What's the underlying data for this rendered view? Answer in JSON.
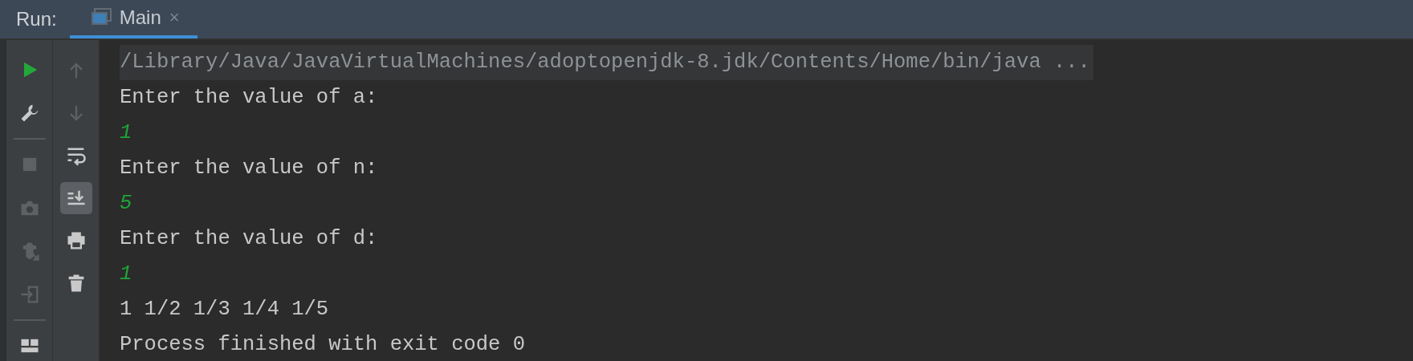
{
  "header": {
    "label": "Run:",
    "tabs": [
      {
        "label": "Main",
        "close": "×",
        "selected": true
      }
    ]
  },
  "left_toolbar": [
    {
      "kind": "run",
      "disabled": false
    },
    {
      "kind": "wrench",
      "disabled": false
    },
    {
      "kind": "separator"
    },
    {
      "kind": "stop",
      "disabled": true
    },
    {
      "kind": "camera",
      "disabled": true
    },
    {
      "kind": "bug",
      "disabled": true
    },
    {
      "kind": "exit",
      "disabled": true
    },
    {
      "kind": "separator"
    },
    {
      "kind": "layout",
      "disabled": false
    }
  ],
  "console_toolbar": [
    {
      "kind": "up",
      "disabled": true,
      "selected": false
    },
    {
      "kind": "down",
      "disabled": true,
      "selected": false
    },
    {
      "kind": "wrap",
      "disabled": false,
      "selected": false
    },
    {
      "kind": "scroll-end",
      "disabled": false,
      "selected": true
    },
    {
      "kind": "print",
      "disabled": false,
      "selected": false
    },
    {
      "kind": "trash",
      "disabled": false,
      "selected": false
    }
  ],
  "console": [
    {
      "kind": "command",
      "text": "/Library/Java/JavaVirtualMachines/adoptopenjdk-8.jdk/Contents/Home/bin/java ..."
    },
    {
      "kind": "output",
      "text": "Enter the value of a:"
    },
    {
      "kind": "input",
      "text": "1"
    },
    {
      "kind": "output",
      "text": "Enter the value of n:"
    },
    {
      "kind": "input",
      "text": "5"
    },
    {
      "kind": "output",
      "text": "Enter the value of d:"
    },
    {
      "kind": "input",
      "text": "1"
    },
    {
      "kind": "output",
      "text": "1 1/2 1/3 1/4 1/5"
    },
    {
      "kind": "output",
      "text": "Process finished with exit code 0"
    }
  ]
}
